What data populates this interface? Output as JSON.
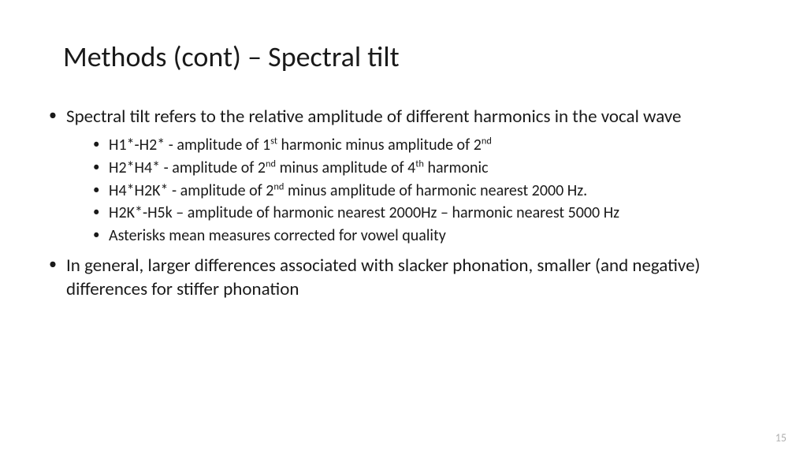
{
  "title": "Methods (cont) – Spectral tilt",
  "bullets": {
    "b1": "Spectral tilt refers to the relative amplitude of different harmonics in the vocal wave",
    "sub": {
      "s1_a": "H1*-H2* - amplitude of 1",
      "s1_sup1": "st",
      "s1_b": "  harmonic minus amplitude of 2",
      "s1_sup2": "nd",
      "s2_a": "H2*H4* - amplitude of 2",
      "s2_sup1": "nd",
      "s2_b": " minus amplitude of 4",
      "s2_sup2": "th",
      "s2_c": " harmonic",
      "s3_a": "H4*H2K* - amplitude of 2",
      "s3_sup1": "nd",
      "s3_b": " minus amplitude of harmonic nearest 2000 Hz.",
      "s4": "H2K*-H5k – amplitude of harmonic nearest 2000Hz – harmonic nearest 5000 Hz",
      "s5": "Asterisks mean measures corrected for vowel quality"
    },
    "b2": "In general, larger differences associated with slacker phonation, smaller (and negative) differences for stiffer phonation"
  },
  "page_number": "15"
}
